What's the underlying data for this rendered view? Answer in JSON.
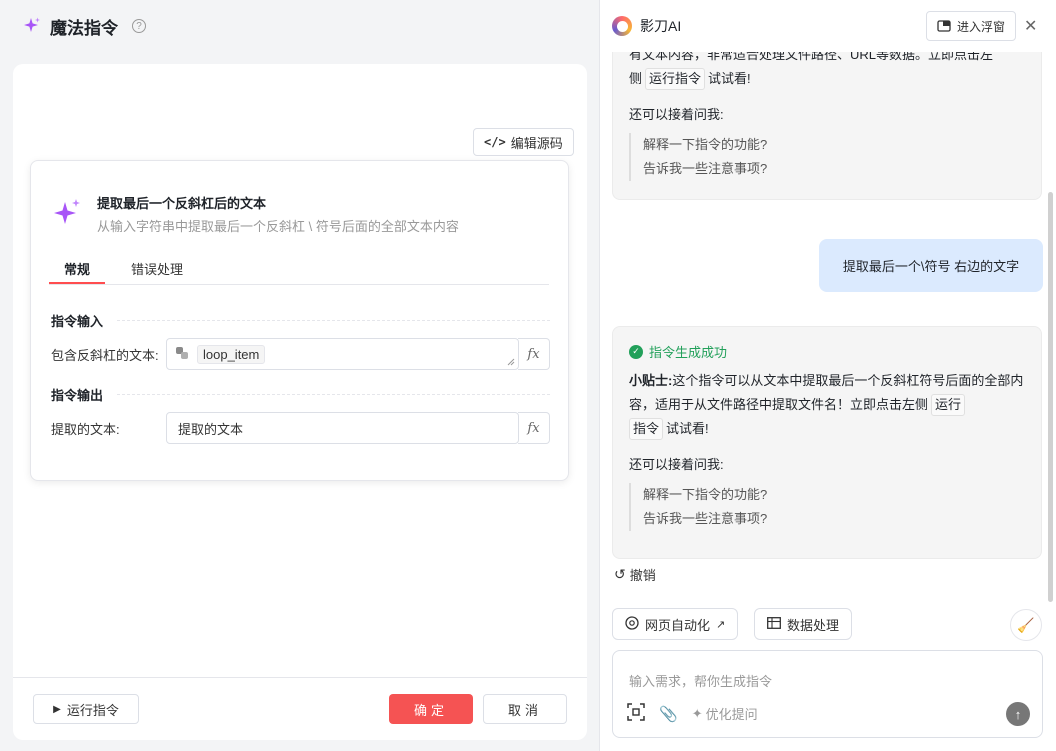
{
  "left": {
    "title": "魔法指令",
    "help_icon": "?",
    "edit_source_label": "编辑源码",
    "command": {
      "title": "提取最后一个反斜杠后的文本",
      "description": "从输入字符串中提取最后一个反斜杠 \\ 符号后面的全部文本内容"
    },
    "tabs": [
      {
        "label": "常规",
        "active": true
      },
      {
        "label": "错误处理",
        "active": false
      }
    ],
    "input_section": "指令输入",
    "input_field": {
      "label": "包含反斜杠的文本:",
      "value": "loop_item"
    },
    "output_section": "指令输出",
    "output_field": {
      "label": "提取的文本:",
      "value": "提取的文本"
    },
    "fx_label": "fx",
    "run_label": "运行指令",
    "ok_label": "确定",
    "cancel_label": "取消"
  },
  "right": {
    "app_name": "影刀AI",
    "float_label": "进入浮窗",
    "msg1": {
      "partial_line": "有文本内容，非常适合处理文件路径、URL等数据。立即点击左",
      "line2_prefix": "侧",
      "run_chip": "运行指令",
      "line2_suffix": "试试看!",
      "followup": "还可以接着问我:",
      "questions": [
        "解释一下指令的功能?",
        "告诉我一些注意事项?"
      ]
    },
    "user_msg": "提取最后一个\\符号 右边的文字",
    "msg2": {
      "success": "指令生成成功",
      "tip_label": "小贴士:",
      "tip_text": "这个指令可以从文本中提取最后一个反斜杠符号后面的全部内容，适用于从文件路径中提取文件名！立即点击左侧",
      "run_chip_a": "运行",
      "run_chip_b": "指令",
      "tip_suffix": "试试看!",
      "followup": "还可以接着问我:",
      "questions": [
        "解释一下指令的功能?",
        "告诉我一些注意事项?"
      ]
    },
    "undo_label": "撤销",
    "quick_actions": [
      "网页自动化",
      "数据处理"
    ],
    "input_placeholder": "输入需求，帮你生成指令",
    "optimize_label": "优化提问"
  },
  "colors": {
    "accent_red": "#f55353",
    "success_green": "#22a05a",
    "user_bubble": "#dbeafe"
  }
}
